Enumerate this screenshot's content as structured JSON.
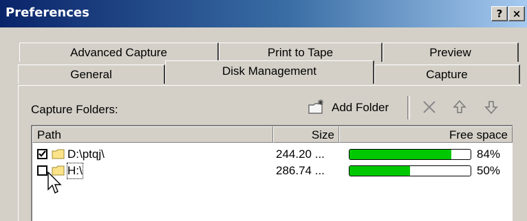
{
  "window": {
    "title": "Preferences",
    "help_label": "?",
    "close_label": "×"
  },
  "tabs": {
    "row_back": [
      "Advanced Capture",
      "Print to Tape",
      "Preview"
    ],
    "row_front": [
      "General",
      "Disk Management",
      "Capture"
    ],
    "active": "Disk Management"
  },
  "panel": {
    "capture_folders_label": "Capture Folders:",
    "add_folder_label": "Add Folder",
    "toolbar_icons": [
      "add-folder-icon",
      "delete-icon",
      "move-up-icon",
      "move-down-icon"
    ]
  },
  "table": {
    "columns": [
      "Path",
      "Size",
      "Free space"
    ],
    "rows": [
      {
        "checked": true,
        "path": "D:\\ptqj\\",
        "size": "244.20 ...",
        "free_space": "84%",
        "free_fraction": 0.84
      },
      {
        "checked": false,
        "path": "H:\\",
        "size": "286.74 ...",
        "free_space": "50%",
        "free_fraction": 0.5
      }
    ]
  },
  "colors": {
    "title_start": "#0a246a",
    "title_end": "#a6caf0",
    "bar_fill": "#00c800",
    "face": "#d4d0c8"
  }
}
